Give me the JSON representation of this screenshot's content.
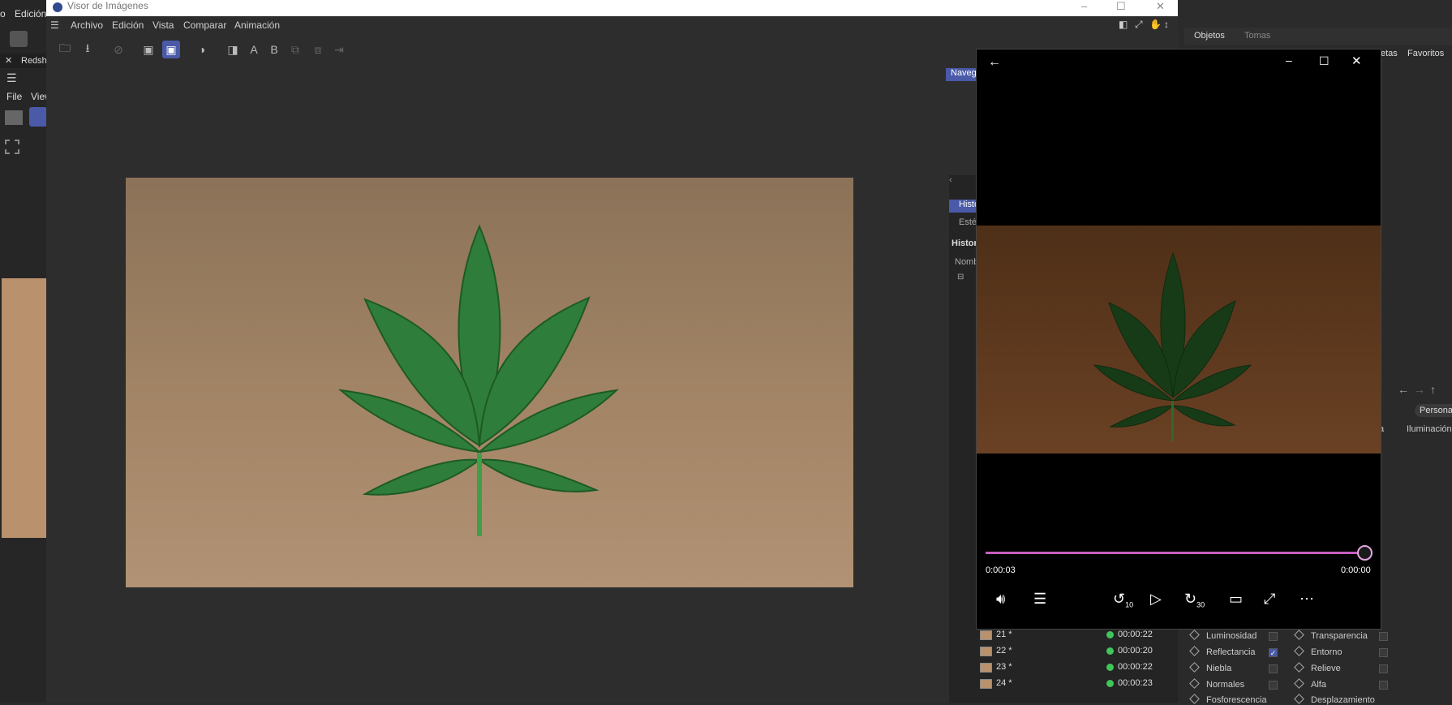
{
  "background_app": {
    "menu_left": "o",
    "menu_edit": "Edición",
    "tab": "Redshi",
    "menu_file": "File",
    "menu_view": "View"
  },
  "viewer": {
    "title": "Visor de Imágenes",
    "menu": [
      "Archivo",
      "Edición",
      "Vista",
      "Comparar",
      "Animación"
    ],
    "toolbar_letters": [
      "A",
      "B"
    ],
    "nav_tab": "Naveg",
    "hist_tab": "Histo",
    "est_tab": "Esté",
    "hist_header": "Histor",
    "col_name": "Nomb",
    "history_rows": [
      {
        "num": "21 *",
        "time": "00:00:22"
      },
      {
        "num": "22 *",
        "time": "00:00:20"
      },
      {
        "num": "23 *",
        "time": "00:00:22"
      },
      {
        "num": "24 *",
        "time": "00:00:23"
      }
    ]
  },
  "objects_panel": {
    "tabs": [
      "Objetos",
      "Tomas"
    ],
    "right_tabs": [
      "etas",
      "Favoritos"
    ],
    "persona": "Persona",
    "iluminacion": "Iluminación",
    "col_a": "a"
  },
  "material": {
    "left": [
      {
        "label": "Luminosidad",
        "checked": false
      },
      {
        "label": "Reflectancia",
        "checked": true
      },
      {
        "label": "Niebla",
        "checked": false
      },
      {
        "label": "Normales",
        "checked": false
      },
      {
        "label": "Fosforescencia",
        "checked": false
      }
    ],
    "right": [
      {
        "label": "Transparencia",
        "checked": false
      },
      {
        "label": "Entorno",
        "checked": false
      },
      {
        "label": "Relieve",
        "checked": false
      },
      {
        "label": "Alfa",
        "checked": false
      },
      {
        "label": "Desplazamiento",
        "checked": false
      }
    ]
  },
  "player": {
    "elapsed": "0:00:03",
    "remaining": "0:00:00",
    "progress": 1.0,
    "rewind_label": "10",
    "forward_label": "30",
    "accent": "#c35ec0"
  }
}
